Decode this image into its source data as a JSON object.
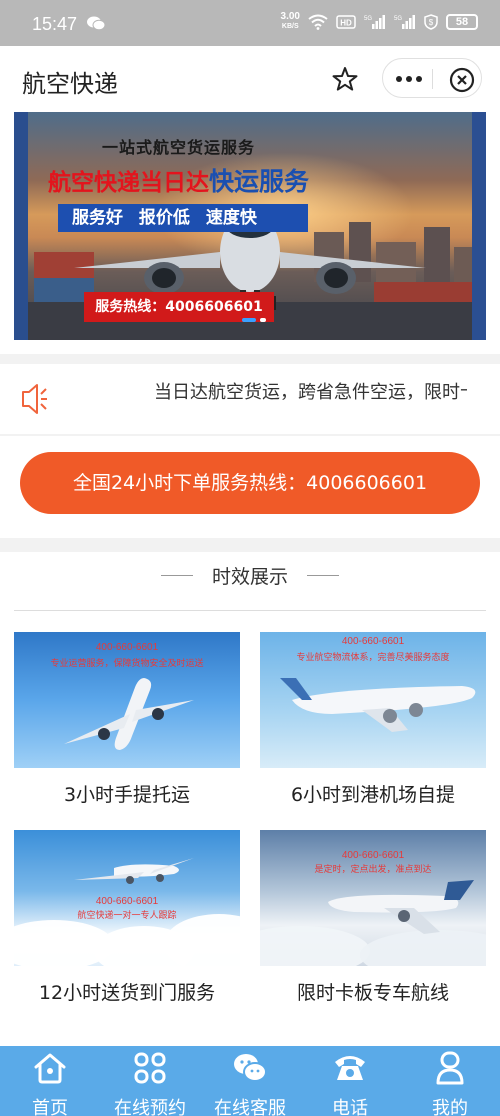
{
  "status_bar": {
    "time": "15:47",
    "net_speed_value": "3.00",
    "net_speed_unit": "KB/S",
    "battery": "58"
  },
  "header": {
    "title": "航空快递"
  },
  "banner": {
    "headline1": "一站式航空货运服务",
    "headline2_red": "航空快递当日达",
    "headline2_blue": "快运服务",
    "tags": "服务好 报价低 速度快",
    "hotline": "服务热线：4006606601",
    "active_slide": 1,
    "slide_count": 2
  },
  "notice": {
    "text": "当日达航空货运，跨省急件空运，限时卡板专车航线"
  },
  "hotline_button": {
    "label": "全国24小时下单服务热线：4006606601"
  },
  "section": {
    "title": "时效展示",
    "cards": [
      {
        "caption": "3小时手提托运",
        "phone": "400-660-6601",
        "slogan": "专业运营服务，保障货物安全及时运送"
      },
      {
        "caption": "6小时到港机场自提",
        "phone": "400-660-6601",
        "slogan": "专业航空物流体系，完善尽美服务态度"
      },
      {
        "caption": "12小时送货到门服务",
        "phone": "400-660-6601",
        "slogan": "航空快递一对一专人跟踪"
      },
      {
        "caption": "限时卡板专车航线",
        "phone": "400-660-6601",
        "slogan": "是定时，定点出发，准点到达"
      }
    ]
  },
  "tabbar": {
    "items": [
      {
        "label": "首页",
        "icon": "home-icon"
      },
      {
        "label": "在线预约",
        "icon": "grid-icon"
      },
      {
        "label": "在线客服",
        "icon": "chat-icon"
      },
      {
        "label": "电话",
        "icon": "phone-icon"
      },
      {
        "label": "我的",
        "icon": "user-icon"
      }
    ]
  },
  "colors": {
    "accent": "#f05a28",
    "tabbar": "#5aaae8",
    "status_bar": "#b8b8b8"
  }
}
